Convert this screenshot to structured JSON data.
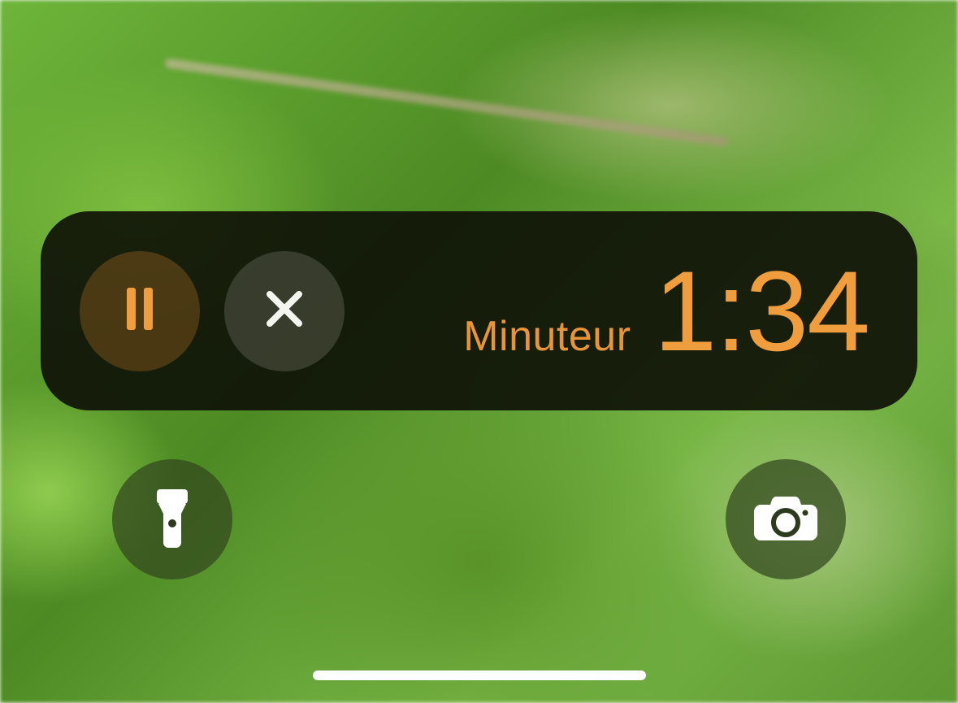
{
  "timer": {
    "label": "Minuteur",
    "time": "1:34",
    "accent_color": "#f09d3e"
  },
  "quick_actions": {
    "flashlight": "flashlight",
    "camera": "camera"
  }
}
